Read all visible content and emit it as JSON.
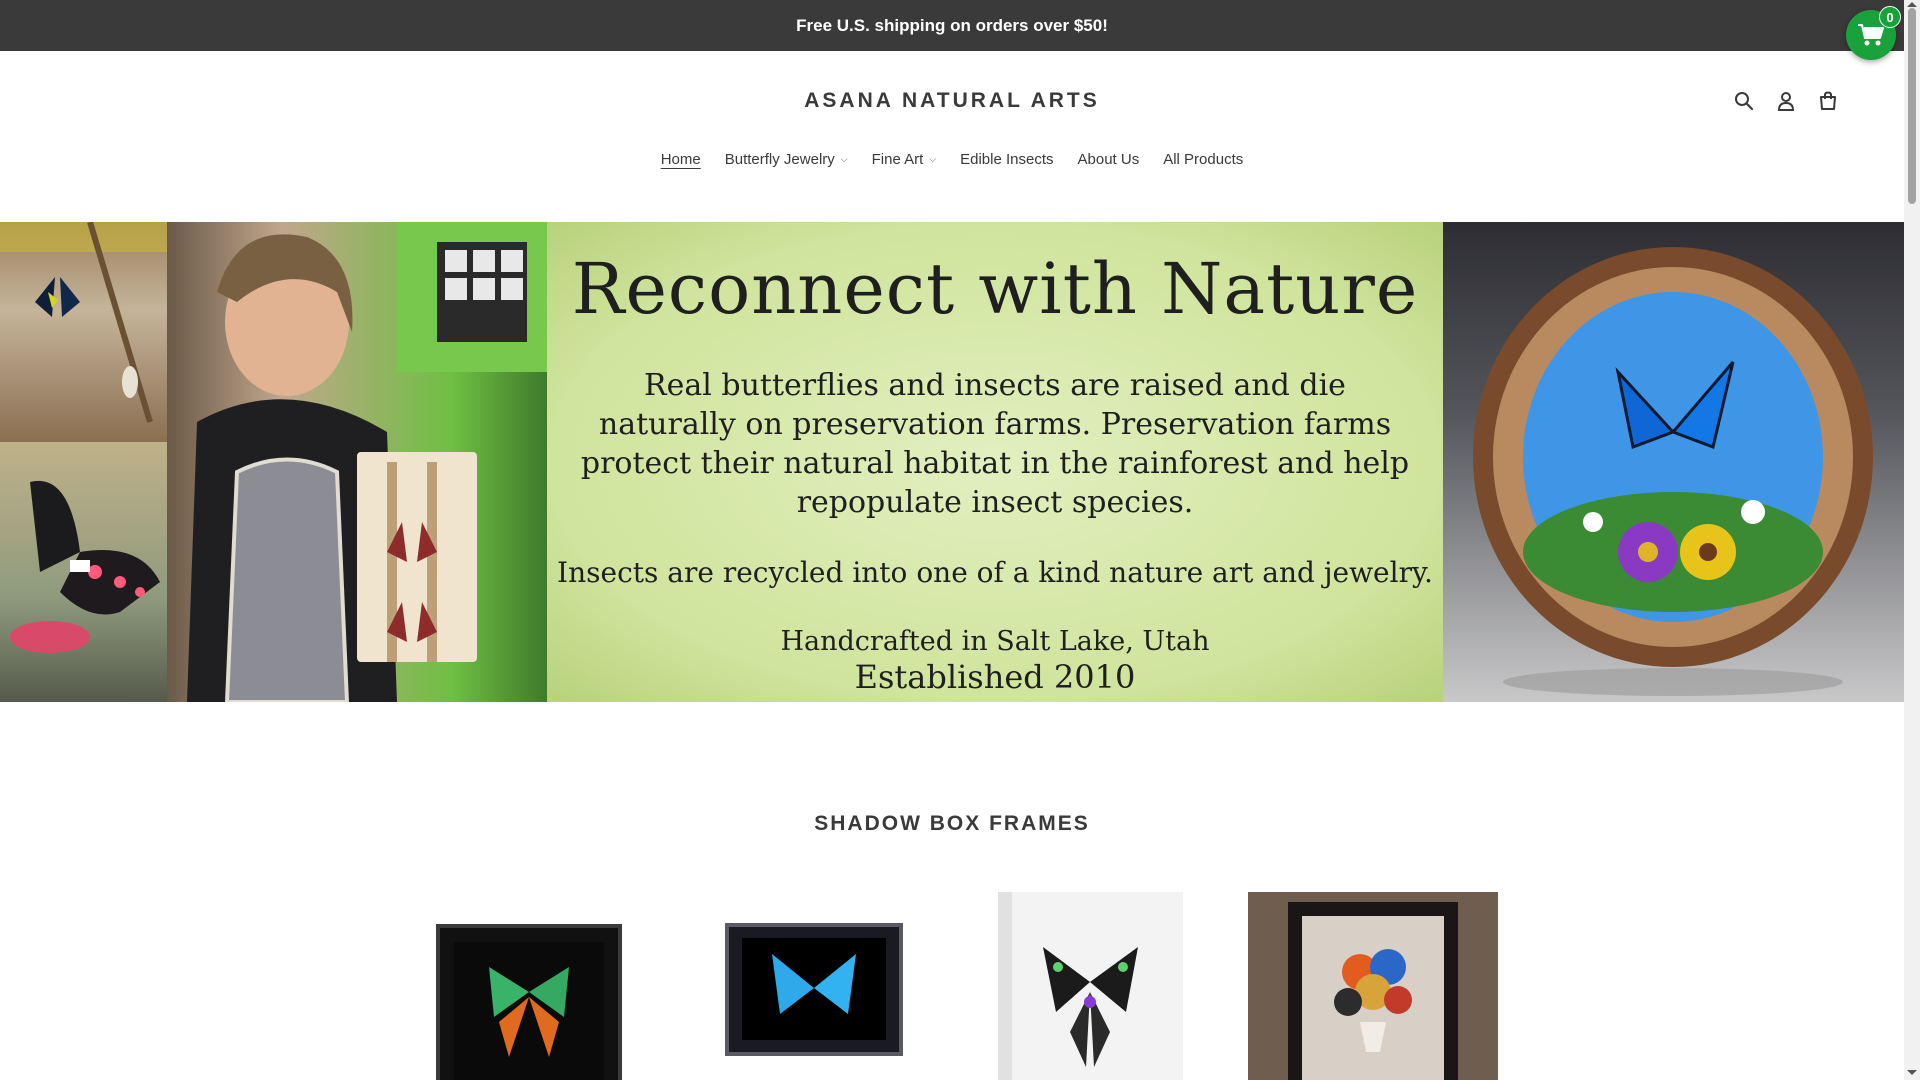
{
  "announcement": {
    "text": "Free U.S. shipping on orders over $50!"
  },
  "header": {
    "logo": "ASANA NATURAL ARTS",
    "icons": [
      "search-icon",
      "account-icon",
      "cart-icon"
    ]
  },
  "nav": {
    "items": [
      {
        "label": "Home",
        "active": true,
        "dropdown": false
      },
      {
        "label": "Butterfly Jewelry",
        "active": false,
        "dropdown": true
      },
      {
        "label": "Fine Art",
        "active": false,
        "dropdown": true
      },
      {
        "label": "Edible Insects",
        "active": false,
        "dropdown": false
      },
      {
        "label": "About Us",
        "active": false,
        "dropdown": false
      },
      {
        "label": "All Products",
        "active": false,
        "dropdown": false
      }
    ]
  },
  "floating_cart": {
    "count": "0",
    "color": "#19a23b"
  },
  "hero": {
    "title": "Reconnect with Nature",
    "body": "Real butterflies and insects are raised and die naturally on preservation farms. Preservation farms protect their natural habitat in the rainforest and help repopulate insect species.",
    "recycle": "Insects are recycled into one of a kind nature art and jewelry.",
    "handcrafted": "Handcrafted in Salt Lake, Utah",
    "established": "Established 2010"
  },
  "collection": {
    "title": "SHADOW BOX FRAMES",
    "products": [
      {
        "image": "sunset-moth-black-frame"
      },
      {
        "image": "blue-morpho-black-frame"
      },
      {
        "image": "swallowtail-white-frame"
      },
      {
        "image": "butterfly-balloon-shadow-box"
      }
    ]
  },
  "colors": {
    "announcement_bg": "#3a3a3a",
    "text": "#3a3a3a",
    "accent_green": "#19a23b"
  }
}
